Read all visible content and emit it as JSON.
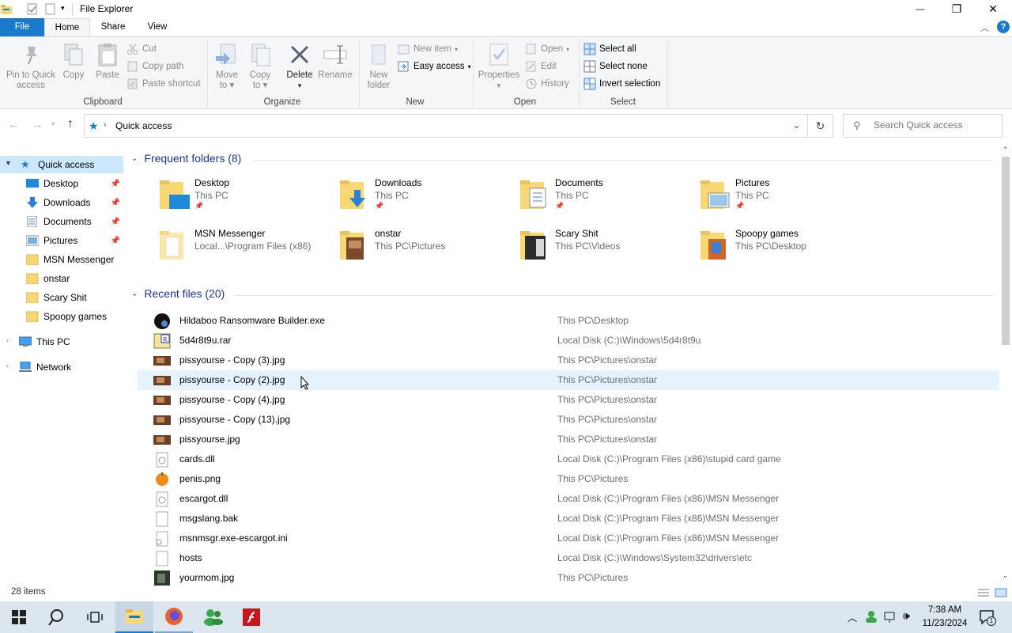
{
  "window": {
    "title": "File Explorer",
    "minimize": "—",
    "restore": "❐",
    "close": "✕"
  },
  "tabs": {
    "file": "File",
    "home": "Home",
    "share": "Share",
    "view": "View",
    "help": "?"
  },
  "ribbon": {
    "clipboard": {
      "label": "Clipboard",
      "pin_line1": "Pin to Quick",
      "pin_line2": "access",
      "copy": "Copy",
      "paste": "Paste",
      "cut": "Cut",
      "copy_path": "Copy path",
      "paste_shortcut": "Paste shortcut"
    },
    "organize": {
      "label": "Organize",
      "move_to_1": "Move",
      "move_to_2": "to",
      "copy_to_1": "Copy",
      "copy_to_2": "to",
      "delete": "Delete",
      "rename": "Rename"
    },
    "new": {
      "label": "New",
      "new_folder_1": "New",
      "new_folder_2": "folder",
      "new_item": "New item",
      "easy_access": "Easy access"
    },
    "open": {
      "label": "Open",
      "properties": "Properties",
      "open": "Open",
      "edit": "Edit",
      "history": "History"
    },
    "select": {
      "label": "Select",
      "select_all": "Select all",
      "select_none": "Select none",
      "invert_selection": "Invert selection"
    }
  },
  "address": {
    "path": "Quick access",
    "search_placeholder": "Search Quick access"
  },
  "nav": {
    "items": [
      {
        "label": "Quick access",
        "icon": "star-icon"
      },
      {
        "label": "Desktop",
        "icon": "desktop-icon",
        "pinned": true
      },
      {
        "label": "Downloads",
        "icon": "download-icon",
        "pinned": true
      },
      {
        "label": "Documents",
        "icon": "document-icon",
        "pinned": true
      },
      {
        "label": "Pictures",
        "icon": "pictures-icon",
        "pinned": true
      },
      {
        "label": "MSN Messenger",
        "icon": "folder-icon"
      },
      {
        "label": "onstar",
        "icon": "folder-icon"
      },
      {
        "label": "Scary Shit",
        "icon": "folder-icon"
      },
      {
        "label": "Spoopy games",
        "icon": "folder-icon"
      },
      {
        "label": "This PC",
        "icon": "computer-icon"
      },
      {
        "label": "Network",
        "icon": "network-icon"
      }
    ]
  },
  "frequent": {
    "heading": "Frequent folders (8)",
    "folders": [
      {
        "name": "Desktop",
        "location": "This PC",
        "pinned": true
      },
      {
        "name": "Downloads",
        "location": "This PC",
        "pinned": true
      },
      {
        "name": "Documents",
        "location": "This PC",
        "pinned": true
      },
      {
        "name": "Pictures",
        "location": "This PC",
        "pinned": true
      },
      {
        "name": "MSN Messenger",
        "location": "Local...\\Program Files (x86)"
      },
      {
        "name": "onstar",
        "location": "This PC\\Pictures"
      },
      {
        "name": "Scary Shit",
        "location": "This PC\\Videos"
      },
      {
        "name": "Spoopy games",
        "location": "This PC\\Desktop"
      }
    ]
  },
  "recent": {
    "heading": "Recent files (20)",
    "files": [
      {
        "name": "Hildaboo Ransomware Builder.exe",
        "path": "This PC\\Desktop",
        "icon": "exe-icon"
      },
      {
        "name": "5d4r8t9u.rar",
        "path": "Local Disk (C:)\\Windows\\5d4r8t9u",
        "icon": "rar-icon"
      },
      {
        "name": "pissyourse - Copy (3).jpg",
        "path": "This PC\\Pictures\\onstar",
        "icon": "image-icon"
      },
      {
        "name": "pissyourse - Copy (2).jpg",
        "path": "This PC\\Pictures\\onstar",
        "icon": "image-icon"
      },
      {
        "name": "pissyourse - Copy (4).jpg",
        "path": "This PC\\Pictures\\onstar",
        "icon": "image-icon"
      },
      {
        "name": "pissyourse - Copy (13).jpg",
        "path": "This PC\\Pictures\\onstar",
        "icon": "image-icon"
      },
      {
        "name": "pissyourse.jpg",
        "path": "This PC\\Pictures\\onstar",
        "icon": "image-icon"
      },
      {
        "name": "cards.dll",
        "path": "Local Disk (C:)\\Program Files (x86)\\stupid card game",
        "icon": "dll-icon"
      },
      {
        "name": "penis.png",
        "path": "This PC\\Pictures",
        "icon": "png-icon"
      },
      {
        "name": "escargot.dll",
        "path": "Local Disk (C:)\\Program Files (x86)\\MSN Messenger",
        "icon": "dll-icon"
      },
      {
        "name": "msgslang.bak",
        "path": "Local Disk (C:)\\Program Files (x86)\\MSN Messenger",
        "icon": "file-icon"
      },
      {
        "name": "msnmsgr.exe-escargot.ini",
        "path": "Local Disk (C:)\\Program Files (x86)\\MSN Messenger",
        "icon": "ini-icon"
      },
      {
        "name": "hosts",
        "path": "Local Disk (C:)\\Windows\\System32\\drivers\\etc",
        "icon": "file-icon"
      },
      {
        "name": "yourmom.jpg",
        "path": "This PC\\Pictures",
        "icon": "image-icon"
      }
    ]
  },
  "status": {
    "items": "28 items"
  },
  "taskbar": {
    "time": "7:38 AM",
    "date": "11/23/2024",
    "notifications": "1"
  },
  "colors": {
    "accent": "#1979ca",
    "nav_selected": "#cce8ff",
    "row_hover": "#e5f3ff",
    "heading": "#1e3287",
    "folder": "#f8d775",
    "taskbar": "#dbe6ee"
  }
}
